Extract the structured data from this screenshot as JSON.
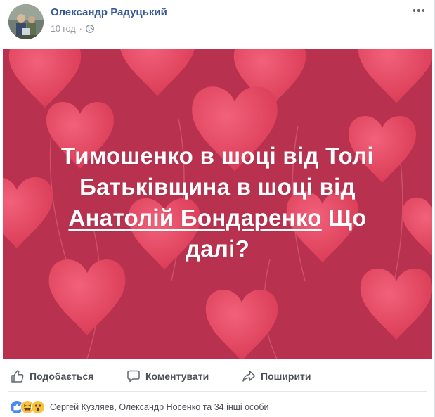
{
  "post": {
    "author": "Олександр Радуцький",
    "time": "10 год",
    "separator": "·",
    "privacy_icon": "globe-icon",
    "more_icon": "more-options-icon"
  },
  "banner": {
    "line1": "Тимошенко в шоці від Толі",
    "line2": "Батьківщина в шоці від",
    "tag": "Анатолій Бондаренко",
    "line3_rest": " Що",
    "line4": "далі?",
    "background_color": "#b8324f",
    "heart_color": "#e5485f",
    "text_color": "#ffffff"
  },
  "actions": {
    "like": "Подобається",
    "comment": "Коментувати",
    "share": "Поширити"
  },
  "reactions": {
    "icons": [
      "like-icon",
      "haha-icon",
      "wow-icon"
    ],
    "text": "Сергей Кузляев, Олександр Носенко та 34 інші особи"
  },
  "colors": {
    "link_blue": "#365899",
    "meta_gray": "#90949c",
    "action_gray": "#4b4f56"
  }
}
